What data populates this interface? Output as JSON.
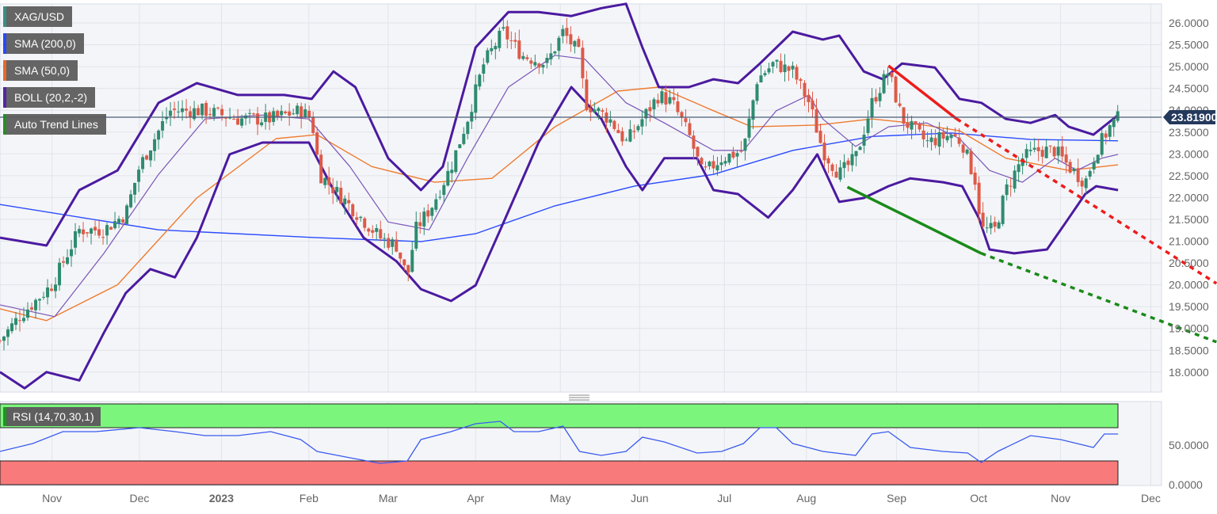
{
  "legend": [
    {
      "label": "XAG/USD",
      "color": "#2e8b7a"
    },
    {
      "label": "SMA (200,0)",
      "color": "#1f3fff"
    },
    {
      "label": "SMA (50,0)",
      "color": "#e8601c"
    },
    {
      "label": "BOLL (20,2,-2)",
      "color": "#4b1aa0"
    },
    {
      "label": "Auto Trend Lines",
      "color": "#1a8a1a"
    }
  ],
  "rsi_legend": "RSI (14,70,30,1)",
  "last_price_label": "23.81900",
  "chart_data": {
    "type": "line",
    "title": "XAG/USD",
    "x_unit": "trading-day index from chart start (2022-10-13)",
    "price_axis": {
      "min": 15.2,
      "max": 26.5,
      "ticks": [
        "18.0000",
        "18.5000",
        "19.0000",
        "19.5000",
        "20.0000",
        "20.5000",
        "21.0000",
        "21.5000",
        "22.0000",
        "22.5000",
        "23.0000",
        "23.5000",
        "24.0000",
        "24.5000",
        "25.0000",
        "25.5000",
        "26.0000"
      ]
    },
    "x_ticks": [
      {
        "day": 19,
        "label": "Nov"
      },
      {
        "day": 51,
        "label": "Dec"
      },
      {
        "day": 81,
        "label": "2023"
      },
      {
        "day": 113,
        "label": "Feb"
      },
      {
        "day": 142,
        "label": "Mar"
      },
      {
        "day": 174,
        "label": "Apr"
      },
      {
        "day": 205,
        "label": "May"
      },
      {
        "day": 234,
        "label": "Jun"
      },
      {
        "day": 265,
        "label": "Jul"
      },
      {
        "day": 295,
        "label": "Aug"
      },
      {
        "day": 328,
        "label": "Sep"
      },
      {
        "day": 358,
        "label": "Oct"
      },
      {
        "day": 388,
        "label": "Nov"
      },
      {
        "day": 421,
        "label": "Dec"
      }
    ],
    "last_price": 23.819,
    "close_anchors": [
      [
        0,
        18.72
      ],
      [
        7,
        19.27
      ],
      [
        19,
        20.0
      ],
      [
        29,
        21.26
      ],
      [
        38,
        21.26
      ],
      [
        46,
        21.63
      ],
      [
        51,
        22.71
      ],
      [
        62,
        23.99
      ],
      [
        75,
        23.99
      ],
      [
        87,
        23.8
      ],
      [
        99,
        23.8
      ],
      [
        110,
        23.99
      ],
      [
        114,
        23.8
      ],
      [
        117,
        22.53
      ],
      [
        128,
        21.81
      ],
      [
        139,
        21.08
      ],
      [
        145,
        20.9
      ],
      [
        149,
        20.17
      ],
      [
        152,
        21.26
      ],
      [
        158,
        21.81
      ],
      [
        165,
        22.71
      ],
      [
        171,
        23.8
      ],
      [
        177,
        25.07
      ],
      [
        184,
        25.8
      ],
      [
        191,
        25.26
      ],
      [
        200,
        25.07
      ],
      [
        206,
        25.8
      ],
      [
        212,
        25.26
      ],
      [
        214,
        24.17
      ],
      [
        223,
        23.8
      ],
      [
        229,
        23.26
      ],
      [
        235,
        23.8
      ],
      [
        241,
        24.35
      ],
      [
        246,
        24.17
      ],
      [
        252,
        23.44
      ],
      [
        257,
        22.53
      ],
      [
        264,
        22.9
      ],
      [
        272,
        23.08
      ],
      [
        277,
        24.71
      ],
      [
        283,
        25.07
      ],
      [
        290,
        24.89
      ],
      [
        296,
        24.17
      ],
      [
        301,
        23.08
      ],
      [
        307,
        22.53
      ],
      [
        313,
        22.9
      ],
      [
        319,
        24.17
      ],
      [
        325,
        24.89
      ],
      [
        330,
        23.8
      ],
      [
        339,
        23.26
      ],
      [
        348,
        23.44
      ],
      [
        352,
        23.26
      ],
      [
        357,
        22.35
      ],
      [
        359,
        21.26
      ],
      [
        364,
        21.26
      ],
      [
        368,
        22.17
      ],
      [
        374,
        22.9
      ],
      [
        380,
        23.08
      ],
      [
        386,
        23.08
      ],
      [
        391,
        22.71
      ],
      [
        397,
        22.35
      ],
      [
        401,
        23.08
      ],
      [
        406,
        23.62
      ],
      [
        409,
        23.82
      ]
    ],
    "series": [
      {
        "name": "SMA (200,0)",
        "color": "#2a4bff",
        "points": [
          [
            0,
            21.84
          ],
          [
            58,
            21.26
          ],
          [
            116,
            21.08
          ],
          [
            154,
            20.99
          ],
          [
            174,
            21.17
          ],
          [
            203,
            21.81
          ],
          [
            232,
            22.26
          ],
          [
            261,
            22.53
          ],
          [
            290,
            23.08
          ],
          [
            319,
            23.4
          ],
          [
            348,
            23.48
          ],
          [
            377,
            23.33
          ],
          [
            409,
            23.3
          ]
        ]
      },
      {
        "name": "SMA (50,0)",
        "color": "#ef7b2f",
        "points": [
          [
            0,
            19.45
          ],
          [
            17,
            19.18
          ],
          [
            43,
            20.0
          ],
          [
            72,
            21.99
          ],
          [
            101,
            23.35
          ],
          [
            116,
            23.44
          ],
          [
            136,
            22.71
          ],
          [
            159,
            22.35
          ],
          [
            180,
            22.44
          ],
          [
            203,
            23.62
          ],
          [
            226,
            24.44
          ],
          [
            241,
            24.53
          ],
          [
            261,
            23.99
          ],
          [
            275,
            23.62
          ],
          [
            299,
            23.66
          ],
          [
            319,
            23.8
          ],
          [
            333,
            23.71
          ],
          [
            351,
            23.53
          ],
          [
            368,
            22.9
          ],
          [
            391,
            22.62
          ],
          [
            409,
            22.75
          ]
        ]
      },
      {
        "name": "BOLL upper",
        "color": "#4b1aa0",
        "points": [
          [
            0,
            21.08
          ],
          [
            17,
            20.9
          ],
          [
            29,
            22.17
          ],
          [
            43,
            22.62
          ],
          [
            58,
            24.17
          ],
          [
            72,
            24.62
          ],
          [
            87,
            24.35
          ],
          [
            104,
            24.35
          ],
          [
            114,
            24.26
          ],
          [
            122,
            24.89
          ],
          [
            130,
            24.53
          ],
          [
            142,
            22.9
          ],
          [
            154,
            22.17
          ],
          [
            162,
            22.71
          ],
          [
            174,
            25.44
          ],
          [
            186,
            26.25
          ],
          [
            197,
            26.25
          ],
          [
            209,
            26.16
          ],
          [
            220,
            26.34
          ],
          [
            229,
            26.44
          ],
          [
            235,
            25.44
          ],
          [
            241,
            24.53
          ],
          [
            252,
            24.53
          ],
          [
            261,
            24.71
          ],
          [
            270,
            24.62
          ],
          [
            278,
            25.07
          ],
          [
            290,
            25.8
          ],
          [
            301,
            25.62
          ],
          [
            307,
            25.71
          ],
          [
            316,
            24.89
          ],
          [
            323,
            24.71
          ],
          [
            330,
            25.07
          ],
          [
            342,
            24.98
          ],
          [
            351,
            24.26
          ],
          [
            359,
            24.17
          ],
          [
            368,
            23.8
          ],
          [
            377,
            23.71
          ],
          [
            386,
            23.89
          ],
          [
            391,
            23.62
          ],
          [
            400,
            23.44
          ],
          [
            409,
            23.89
          ]
        ]
      },
      {
        "name": "BOLL middle",
        "color": "#7a55b8",
        "points": [
          [
            0,
            19.54
          ],
          [
            20,
            19.27
          ],
          [
            38,
            20.72
          ],
          [
            58,
            22.53
          ],
          [
            75,
            23.8
          ],
          [
            96,
            23.89
          ],
          [
            113,
            23.8
          ],
          [
            128,
            22.71
          ],
          [
            142,
            21.44
          ],
          [
            157,
            21.26
          ],
          [
            171,
            22.9
          ],
          [
            186,
            24.53
          ],
          [
            203,
            25.26
          ],
          [
            214,
            25.17
          ],
          [
            229,
            24.17
          ],
          [
            243,
            23.71
          ],
          [
            261,
            23.08
          ],
          [
            272,
            23.08
          ],
          [
            284,
            23.99
          ],
          [
            296,
            24.35
          ],
          [
            301,
            23.8
          ],
          [
            313,
            23.17
          ],
          [
            325,
            23.62
          ],
          [
            339,
            23.71
          ],
          [
            351,
            23.35
          ],
          [
            362,
            22.62
          ],
          [
            374,
            22.35
          ],
          [
            386,
            22.9
          ],
          [
            394,
            22.62
          ],
          [
            403,
            22.9
          ],
          [
            409,
            22.99
          ]
        ]
      },
      {
        "name": "BOLL lower",
        "color": "#4b1aa0",
        "points": [
          [
            0,
            18.0
          ],
          [
            9,
            17.63
          ],
          [
            17,
            18.0
          ],
          [
            29,
            17.81
          ],
          [
            38,
            18.9
          ],
          [
            46,
            19.81
          ],
          [
            55,
            20.36
          ],
          [
            64,
            20.17
          ],
          [
            72,
            21.08
          ],
          [
            84,
            22.99
          ],
          [
            96,
            23.26
          ],
          [
            113,
            23.26
          ],
          [
            122,
            22.17
          ],
          [
            133,
            21.08
          ],
          [
            145,
            20.54
          ],
          [
            154,
            19.9
          ],
          [
            165,
            19.63
          ],
          [
            174,
            19.99
          ],
          [
            183,
            21.26
          ],
          [
            197,
            23.26
          ],
          [
            209,
            24.53
          ],
          [
            220,
            23.8
          ],
          [
            229,
            22.71
          ],
          [
            235,
            22.17
          ],
          [
            243,
            22.9
          ],
          [
            255,
            22.9
          ],
          [
            261,
            22.17
          ],
          [
            270,
            22.08
          ],
          [
            281,
            21.54
          ],
          [
            290,
            22.17
          ],
          [
            299,
            22.99
          ],
          [
            307,
            21.9
          ],
          [
            316,
            21.99
          ],
          [
            325,
            22.26
          ],
          [
            333,
            22.44
          ],
          [
            345,
            22.35
          ],
          [
            352,
            22.26
          ],
          [
            358,
            21.54
          ],
          [
            362,
            20.81
          ],
          [
            371,
            20.72
          ],
          [
            383,
            20.81
          ],
          [
            390,
            21.44
          ],
          [
            397,
            22.08
          ],
          [
            401,
            22.26
          ],
          [
            409,
            22.17
          ]
        ]
      }
    ],
    "trend_lines": [
      {
        "name": "resistance",
        "color": "#ee1c1c",
        "solid": [
          [
            325,
            25.02
          ],
          [
            350,
            23.8
          ]
        ],
        "projected": [
          [
            350,
            23.8
          ],
          [
            445,
            20.03
          ]
        ]
      },
      {
        "name": "support",
        "color": "#1a8a1a",
        "solid": [
          [
            310,
            22.24
          ],
          [
            359,
            20.72
          ]
        ],
        "projected": [
          [
            359,
            20.72
          ],
          [
            445,
            18.69
          ]
        ]
      }
    ],
    "rsi": {
      "name": "RSI (14,70,30,1)",
      "overbought": 70,
      "oversold": 30,
      "ticks": [
        "0.0000",
        "50.0000"
      ],
      "points": [
        [
          0,
          42
        ],
        [
          12,
          52
        ],
        [
          23,
          67
        ],
        [
          35,
          67
        ],
        [
          51,
          72
        ],
        [
          64,
          67
        ],
        [
          75,
          62
        ],
        [
          87,
          62
        ],
        [
          99,
          67
        ],
        [
          110,
          57
        ],
        [
          116,
          42
        ],
        [
          128,
          34
        ],
        [
          139,
          27
        ],
        [
          149,
          30
        ],
        [
          154,
          57
        ],
        [
          165,
          67
        ],
        [
          174,
          77
        ],
        [
          183,
          80
        ],
        [
          188,
          67
        ],
        [
          197,
          67
        ],
        [
          206,
          74
        ],
        [
          212,
          42
        ],
        [
          220,
          37
        ],
        [
          229,
          42
        ],
        [
          235,
          60
        ],
        [
          243,
          54
        ],
        [
          255,
          40
        ],
        [
          264,
          42
        ],
        [
          272,
          52
        ],
        [
          278,
          72
        ],
        [
          284,
          72
        ],
        [
          290,
          52
        ],
        [
          301,
          42
        ],
        [
          313,
          37
        ],
        [
          319,
          64
        ],
        [
          325,
          67
        ],
        [
          333,
          47
        ],
        [
          345,
          42
        ],
        [
          354,
          40
        ],
        [
          359,
          28
        ],
        [
          365,
          42
        ],
        [
          377,
          62
        ],
        [
          388,
          57
        ],
        [
          394,
          52
        ],
        [
          400,
          47
        ],
        [
          404,
          64
        ],
        [
          409,
          64
        ]
      ]
    }
  }
}
